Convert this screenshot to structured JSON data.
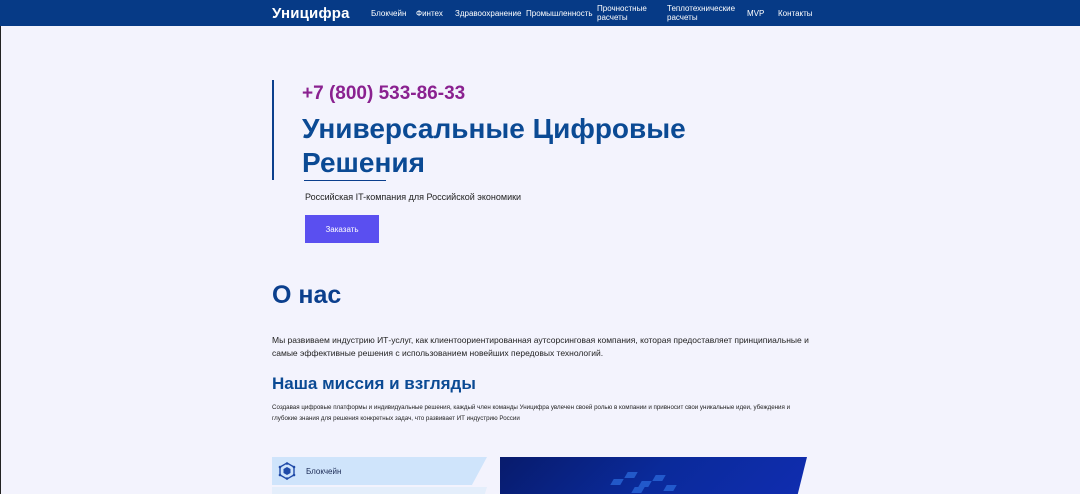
{
  "header": {
    "logo": "Уницифра",
    "nav": [
      {
        "label": "Блокчейн"
      },
      {
        "label": "Финтех"
      },
      {
        "label": "Здравоохранение"
      },
      {
        "label": "Промышленность"
      },
      {
        "label": "Прочностные расчеты"
      },
      {
        "label": "Теплотехнические расчеты"
      },
      {
        "label": "MVP"
      },
      {
        "label": "Контакты"
      }
    ]
  },
  "hero": {
    "phone": "+7 (800) 533-86-33",
    "title": "Универсальные Цифровые Решения",
    "subtitle": "Российская IT-компания для Российской экономики",
    "order_label": "Заказать"
  },
  "about": {
    "title": "О нас",
    "text": "Мы развиваем индустрию ИТ-услуг, как клиентоориентированная аутсорсинговая компания, которая предоставляет принципиальные и самые эффективные решения с использованием новейших передовых технологий.",
    "mission_title": "Наша миссия и взгляды",
    "mission_text": "Создавая цифровые платформы и индивидуальные решения, каждый член команды Уницифра увлечен своей ролью в компании и привносит свои уникальные идеи, убеждения и глубокие знания для решения конкретных задач, что развивает ИТ индустрию России"
  },
  "services": {
    "active_tab": {
      "label": "Блокчейн",
      "icon": "blockchain-icon"
    }
  },
  "colors": {
    "header_bg": "#063a86",
    "accent_phone": "#8a2190",
    "title_blue": "#0b4a94",
    "button": "#5a4ff0",
    "page_bg": "#f3f3fd"
  }
}
